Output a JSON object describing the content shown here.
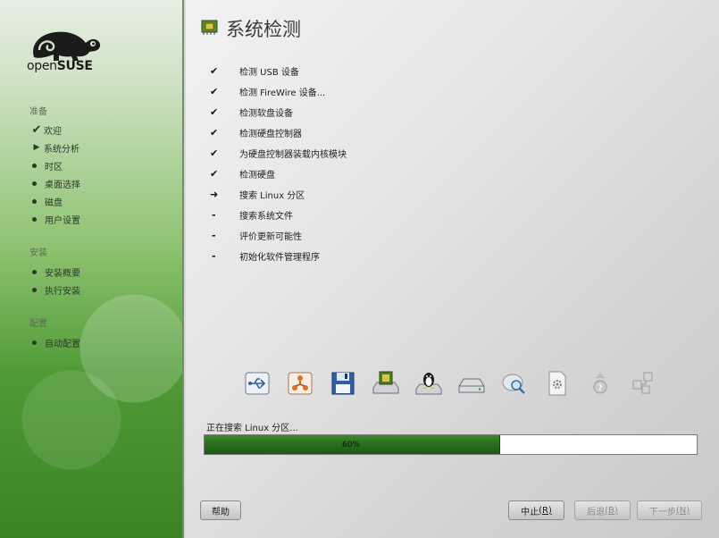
{
  "sidebar": {
    "logo_text_1": "open",
    "logo_text_2": "SUSE",
    "sections": [
      {
        "title": "准备",
        "items": [
          {
            "label": "欢迎",
            "state": "done"
          },
          {
            "label": "系统分析",
            "state": "active"
          },
          {
            "label": "时区",
            "state": "pending"
          },
          {
            "label": "桌面选择",
            "state": "pending"
          },
          {
            "label": "磁盘",
            "state": "pending"
          },
          {
            "label": "用户设置",
            "state": "pending"
          }
        ]
      },
      {
        "title": "安装",
        "items": [
          {
            "label": "安装概要",
            "state": "pending"
          },
          {
            "label": "执行安装",
            "state": "pending"
          }
        ]
      },
      {
        "title": "配置",
        "items": [
          {
            "label": "自动配置",
            "state": "pending"
          }
        ]
      }
    ]
  },
  "main": {
    "title": "系统检测",
    "steps": [
      {
        "label": "检测 USB 设备",
        "status": "done"
      },
      {
        "label": "检测 FireWire 设备...",
        "status": "done"
      },
      {
        "label": "检测软盘设备",
        "status": "done"
      },
      {
        "label": "检测硬盘控制器",
        "status": "done"
      },
      {
        "label": "为硬盘控制器装载内核模块",
        "status": "done"
      },
      {
        "label": "检测硬盘",
        "status": "done"
      },
      {
        "label": "搜索 Linux 分区",
        "status": "current"
      },
      {
        "label": "搜索系统文件",
        "status": "pending"
      },
      {
        "label": "评价更新可能性",
        "status": "pending"
      },
      {
        "label": "初始化软件管理程序",
        "status": "pending"
      }
    ],
    "device_icons": [
      "usb-icon",
      "firewire-icon",
      "floppy-icon",
      "hard-disk-controller-icon",
      "linux-partition-icon",
      "hard-disk-icon",
      "search-files-icon",
      "settings-file-icon",
      "update-question-icon",
      "package-manager-icon"
    ],
    "progress": {
      "label": "正在搜索 Linux 分区...",
      "percent": 60,
      "text": "60%"
    }
  },
  "buttons": {
    "help": "帮助",
    "abort": "中止",
    "abort_key": "(R)",
    "back": "后退",
    "back_key": "(B)",
    "next": "下一步",
    "next_key": "(N)"
  },
  "colors": {
    "accent_green": "#2c6e1f",
    "sidebar_green": "#4f9a35"
  }
}
